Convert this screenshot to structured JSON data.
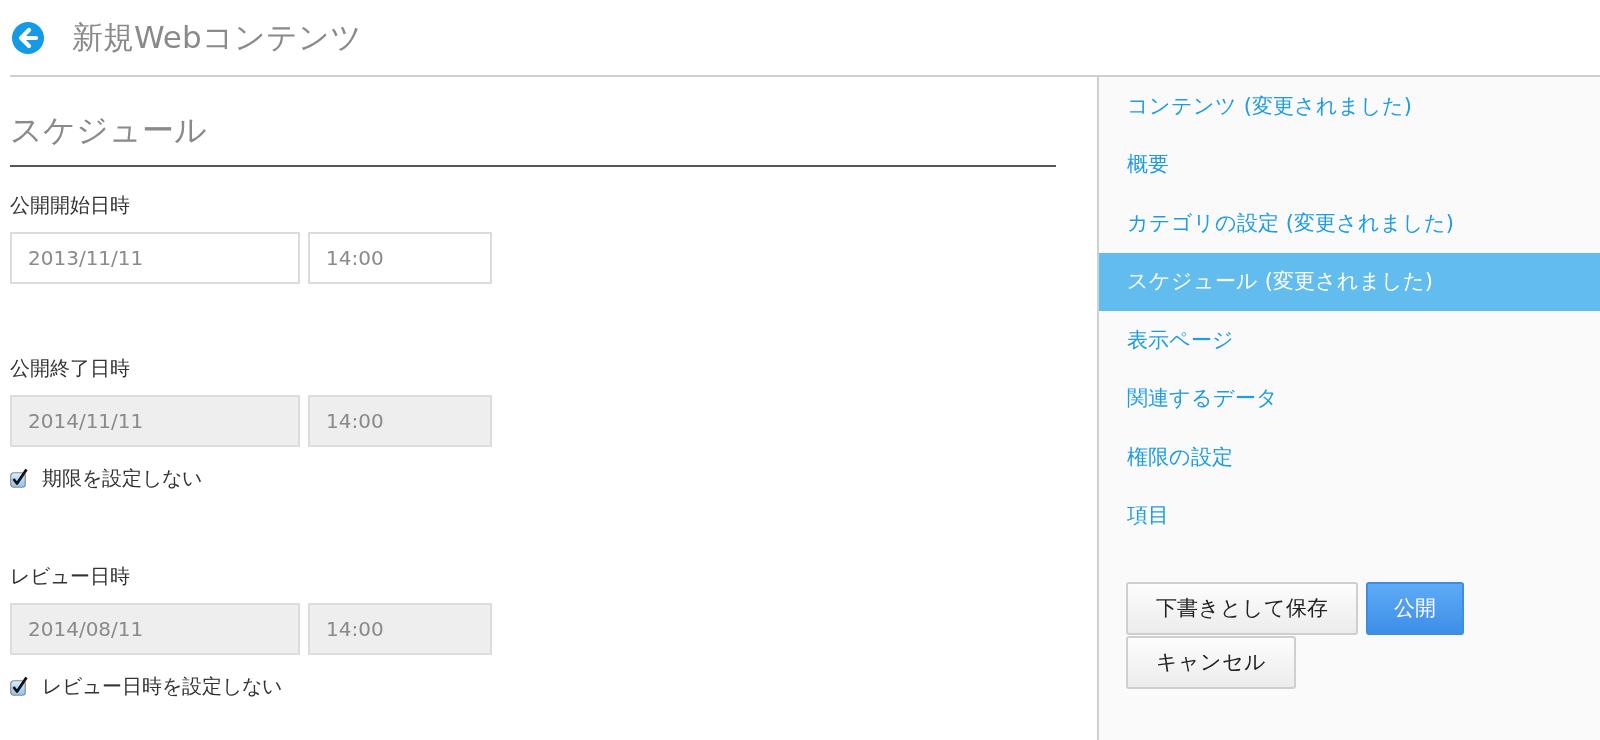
{
  "header": {
    "title": "新規Webコンテンツ"
  },
  "section": {
    "title": "スケジュール"
  },
  "fields": [
    {
      "label": "公開開始日時",
      "date": "2013/11/11",
      "time": "14:00",
      "disabled": false
    },
    {
      "label": "公開終了日時",
      "date": "2014/11/11",
      "time": "14:00",
      "disabled": true,
      "checkbox": {
        "label": "期限を設定しない",
        "checked": true
      }
    },
    {
      "label": "レビュー日時",
      "date": "2014/08/11",
      "time": "14:00",
      "disabled": true,
      "checkbox": {
        "label": "レビュー日時を設定しない",
        "checked": true
      }
    }
  ],
  "sidebar": {
    "items": [
      {
        "label": "コンテンツ (変更されました)",
        "selected": false
      },
      {
        "label": "概要",
        "selected": false
      },
      {
        "label": "カテゴリの設定 (変更されました)",
        "selected": false
      },
      {
        "label": "スケジュール (変更されました)",
        "selected": true
      },
      {
        "label": "表示ページ",
        "selected": false
      },
      {
        "label": "関連するデータ",
        "selected": false
      },
      {
        "label": "権限の設定",
        "selected": false
      },
      {
        "label": "項目",
        "selected": false
      }
    ]
  },
  "buttons": [
    {
      "label": "下書きとして保存",
      "kind": "default"
    },
    {
      "label": "公開",
      "kind": "primary"
    },
    {
      "label": "キャンセル",
      "kind": "default"
    }
  ]
}
